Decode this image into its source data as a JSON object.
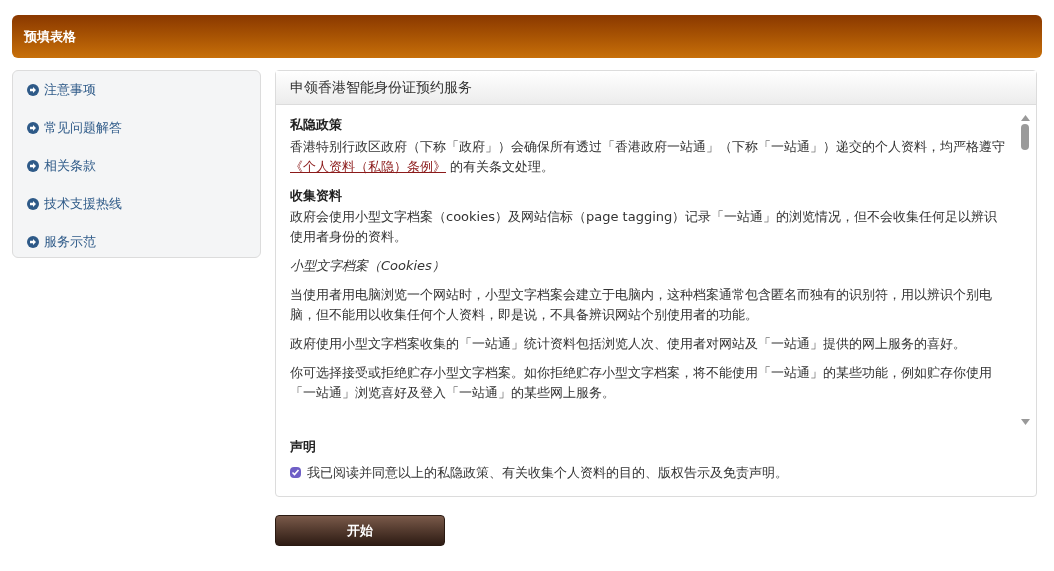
{
  "header": {
    "title": "预填表格"
  },
  "sidebar": {
    "items": [
      {
        "label": "注意事项"
      },
      {
        "label": "常见问题解答"
      },
      {
        "label": "相关条款"
      },
      {
        "label": "技术支援热线"
      },
      {
        "label": "服务示范"
      }
    ]
  },
  "panel": {
    "title": "申领香港智能身份证预约服务",
    "blocks": [
      {
        "kind": "heading",
        "text": "私隐政策"
      },
      {
        "kind": "link_paragraph",
        "text": "香港特别行政区政府（下称「政府」）会确保所有透过「香港政府一站通」（下称「一站通」）递交的个人资料，均严格遵守",
        "link": "《个人资料（私隐）条例》",
        "after": "的有关条文处理。"
      },
      {
        "kind": "heading",
        "text": "收集资料"
      },
      {
        "kind": "paragraph",
        "text": "政府会使用小型文字档案（cookies）及网站信标（page tagging）记录「一站通」的浏览情况，但不会收集任何足以辨识使用者身份的资料。"
      },
      {
        "kind": "subheading",
        "text": "小型文字档案（Cookies）"
      },
      {
        "kind": "paragraph",
        "text": "当使用者用电脑浏览一个网站时，小型文字档案会建立于电脑内，这种档案通常包含匿名而独有的识别符，用以辨识个别电脑，但不能用以收集任何个人资料，即是说，不具备辨识网站个别使用者的功能。"
      },
      {
        "kind": "paragraph",
        "text": "政府使用小型文字档案收集的「一站通」统计资料包括浏览人次、使用者对网站及「一站通」提供的网上服务的喜好。"
      },
      {
        "kind": "paragraph",
        "text": "你可选择接受或拒绝贮存小型文字档案。如你拒绝贮存小型文字档案，将不能使用「一站通」的某些功能，例如贮存你使用「一站通」浏览喜好及登入「一站通」的某些网上服务。"
      }
    ],
    "declaration": {
      "heading": "声明",
      "label": "我已阅读并同意以上的私隐政策、有关收集个人资料的目的、版权告示及免责声明。",
      "checked": true
    }
  },
  "start_button": "开始"
}
